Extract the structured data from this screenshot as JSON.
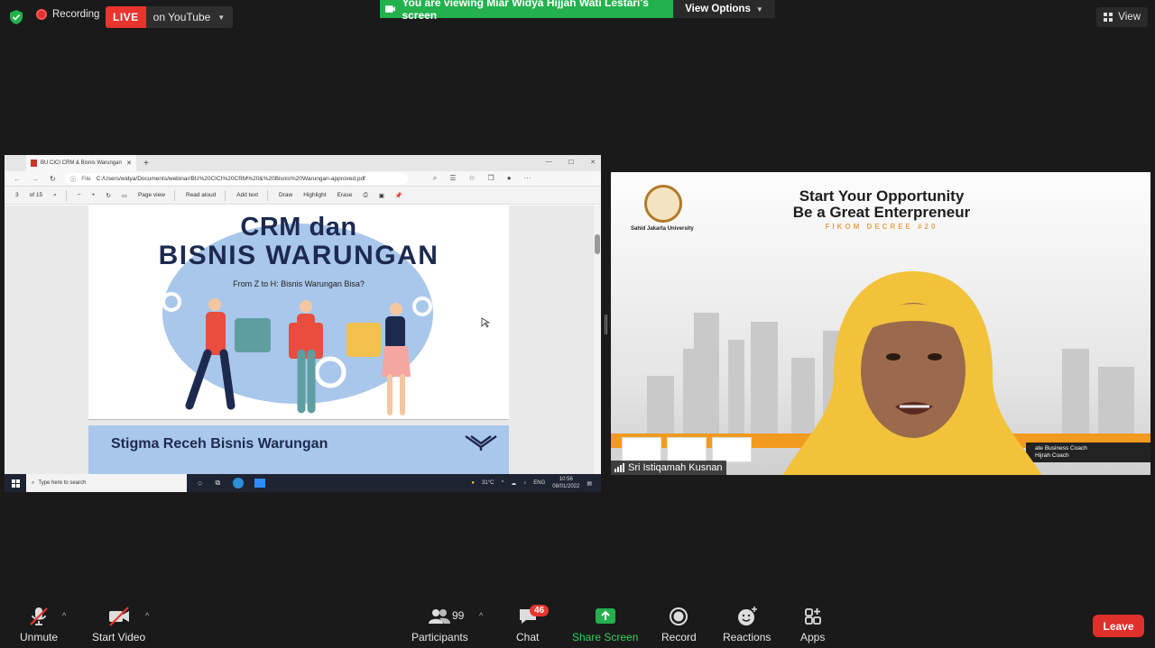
{
  "topbar": {
    "recording_label": "Recording",
    "live_label": "LIVE",
    "stream_target": "on YouTube",
    "viewing_banner": "You are viewing Miar Widya Hijjah Wati Lestari's screen",
    "view_options_label": "View Options",
    "view_label": "View"
  },
  "shared_screen": {
    "browser_tab_title": "BU CICI CRM & Bisnis Warungan",
    "address_prefix": "File",
    "address_url": "C:/Users/widya/Documents/webinar/BU%20CICI%20CRM%20&%20Bisnis%20Warungan-approved.pdf",
    "pdf_toolbar": {
      "page_current": "3",
      "page_total": "of 15",
      "page_view": "Page view",
      "read_aloud": "Read aloud",
      "add_text": "Add text",
      "draw": "Draw",
      "highlight": "Highlight",
      "erase": "Erase"
    },
    "slide1": {
      "title_line1": "CRM dan",
      "title_line2": "BISNIS WARUNGAN",
      "subtitle": "From Z to H: Bisnis Warungan Bisa?"
    },
    "slide2": {
      "title": "Stigma Receh Bisnis Warungan"
    },
    "taskbar": {
      "search_placeholder": "Type here to search",
      "temperature": "31°C",
      "language": "ENG",
      "time": "10:56",
      "date": "08/01/2022"
    }
  },
  "speaker_video": {
    "headline_line1": "Start Your Opportunity",
    "headline_line2": "Be a Great Enterpreneur",
    "event_tag": "FIKOM DECREE #20",
    "university": "Sahid Jakarta University",
    "lower_third_line1": "ate Business Coach",
    "lower_third_line2": "Hijrah Coach",
    "participant_name": "Sri Istiqamah Kusnan"
  },
  "toolbar": {
    "unmute": "Unmute",
    "start_video": "Start Video",
    "participants": "Participants",
    "participant_count": "99",
    "chat": "Chat",
    "chat_badge": "46",
    "share_screen": "Share Screen",
    "record": "Record",
    "reactions": "Reactions",
    "apps": "Apps",
    "leave": "Leave"
  },
  "colors": {
    "live_red": "#e8352e",
    "share_green": "#23b14d",
    "toolbar_green": "#35d05f",
    "slide_blue": "#a9c7ea",
    "slide_navy": "#1d2a4f"
  }
}
